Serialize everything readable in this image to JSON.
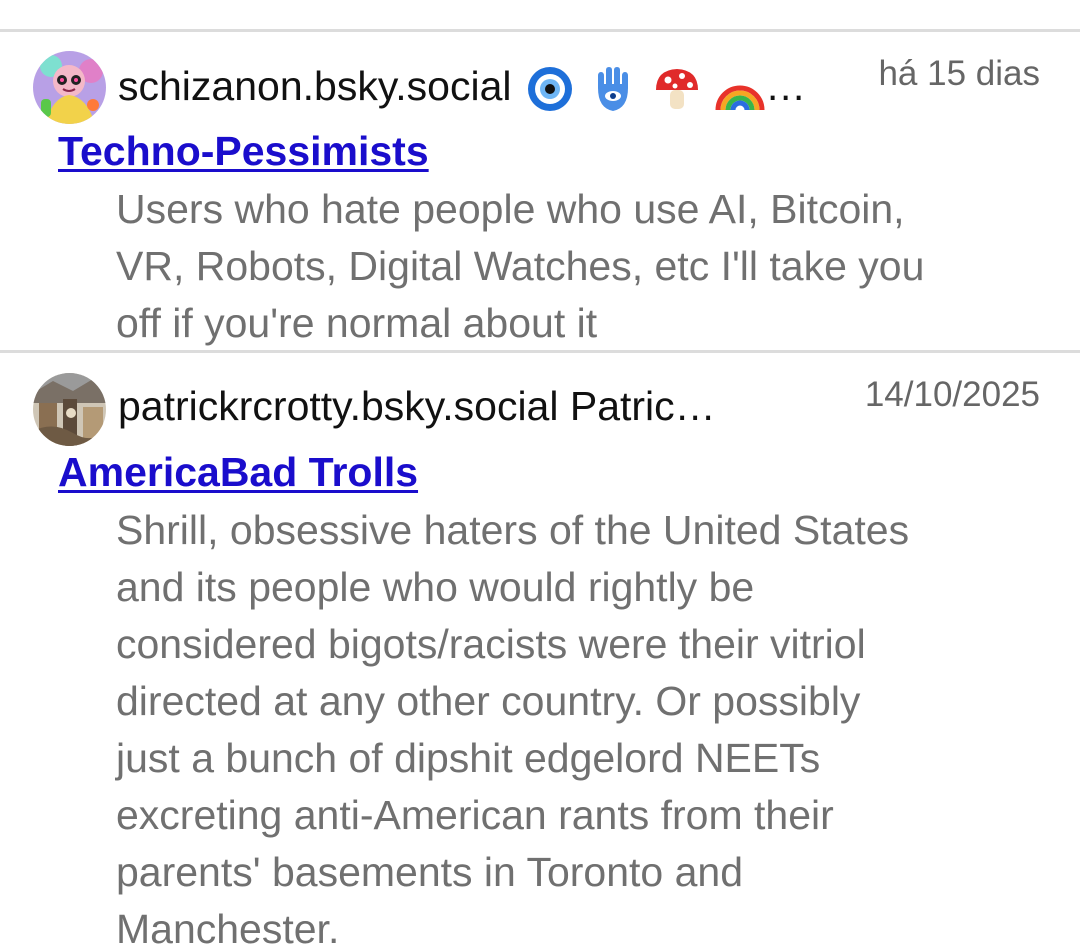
{
  "items": [
    {
      "handle": "schizanon.bsky.social",
      "emoji_names": [
        "nazar-amulet-icon",
        "hamsa-icon",
        "mushroom-icon",
        "rainbow-icon"
      ],
      "ellipsis": "…",
      "time": "há 15 dias",
      "list_name": "Techno-Pessimists",
      "description_lines": [
        "Users who hate people who use AI, Bitcoin,",
        "VR, Robots, Digital Watches, etc I'll take you",
        "off if you're normal about it"
      ]
    },
    {
      "handle": "patrickrcrotty.bsky.social Patric…",
      "time": "14/10/2025",
      "list_name": "AmericaBad Trolls",
      "description_lines": [
        "Shrill, obsessive haters of the United States",
        "and its people who would rightly be",
        "considered bigots/racists were their vitriol",
        "directed at any other country. Or possibly",
        "just a bunch of dipshit edgelord NEETs",
        "excreting anti-American rants from their",
        "parents' basements in Toronto and",
        "Manchester."
      ]
    }
  ],
  "colors": {
    "link": "#1a0dcc",
    "description": "#707070",
    "timestamp": "#666666",
    "divider": "#dcdcdc"
  }
}
